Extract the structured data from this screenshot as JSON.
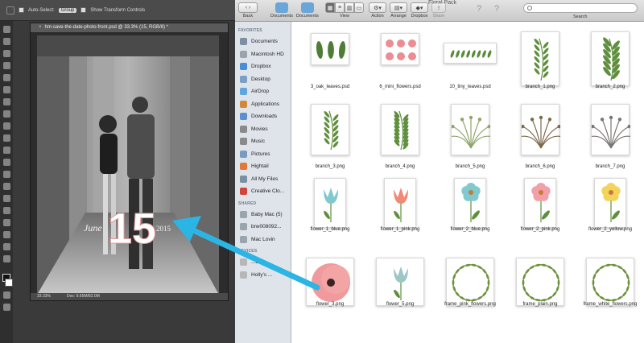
{
  "photoshop": {
    "options_bar": {
      "auto_select_label": "Auto-Select:",
      "auto_select_value": "Group",
      "transform_label": "Show Transform Controls"
    },
    "document_tab": "hm-save-the-date-photo-front.psd @ 33.3% (15, RGB/8) *",
    "canvas_text": {
      "month": "June",
      "day": "15",
      "year": "2015"
    },
    "status": {
      "zoom": "33.33%",
      "doc": "Doc: 9.65M/82.0M"
    }
  },
  "finder": {
    "window_title": "Floral Pack",
    "toolbar": [
      {
        "label": "Back"
      },
      {
        "label": "Documents"
      },
      {
        "label": "Documents"
      },
      {
        "label": "View"
      },
      {
        "label": "Action"
      },
      {
        "label": "Arrange"
      },
      {
        "label": "Dropbox"
      },
      {
        "label": "Share"
      }
    ],
    "search_label": "Search",
    "sidebar": {
      "favorites_header": "FAVORITES",
      "favorites": [
        "Documents",
        "Macintosh HD",
        "Dropbox",
        "Desktop",
        "AirDrop",
        "Applications",
        "Downloads",
        "Movies",
        "Music",
        "Pictures",
        "Hightail",
        "All My Files",
        "Creative Clo..."
      ],
      "shared_header": "SHARED",
      "shared": [
        "Baby Mac (5)",
        "brw008092...",
        "Mac Lovin"
      ],
      "devices_header": "DEVICES",
      "devices": [
        "...313",
        "Holly's ..."
      ]
    },
    "files": [
      {
        "name": "3_oak_leaves.psd",
        "kind": "oak"
      },
      {
        "name": "6_mini_flowers.psd",
        "kind": "mini"
      },
      {
        "name": "10_tiny_leaves.psd",
        "kind": "tiny"
      },
      {
        "name": "branch_1.png",
        "kind": "branch-a"
      },
      {
        "name": "branch_2.png",
        "kind": "branch-b"
      },
      {
        "name": "branch_3.png",
        "kind": "branch-c"
      },
      {
        "name": "branch_4.png",
        "kind": "branch-d"
      },
      {
        "name": "branch_5.png",
        "kind": "fan-green"
      },
      {
        "name": "branch_6.png",
        "kind": "fan-brown"
      },
      {
        "name": "branch_7.png",
        "kind": "fan-gray"
      },
      {
        "name": "flower_1_blue.png",
        "kind": "tulip",
        "color": "#7fc9cf"
      },
      {
        "name": "flower_1_pink.png",
        "kind": "tulip",
        "color": "#f08a78"
      },
      {
        "name": "flower_2_blue.png",
        "kind": "bloom",
        "color": "#7fc9cf"
      },
      {
        "name": "flower_2_pink.png",
        "kind": "bloom",
        "color": "#f2a0a8"
      },
      {
        "name": "flower_2_yellow.png",
        "kind": "bloom",
        "color": "#f3d35c"
      },
      {
        "name": "flower_3.png",
        "kind": "poppy"
      },
      {
        "name": "flower_5.png",
        "kind": "tulip",
        "color": "#9cc7c6"
      },
      {
        "name": "frame_pink_flowers.png",
        "kind": "wreath"
      },
      {
        "name": "frame_plain.png",
        "kind": "wreath"
      },
      {
        "name": "frame_white_flowers.png",
        "kind": "wreath"
      }
    ]
  },
  "colors": {
    "arrow": "#2bb5e4",
    "sidebar": "#dfe4ea"
  }
}
